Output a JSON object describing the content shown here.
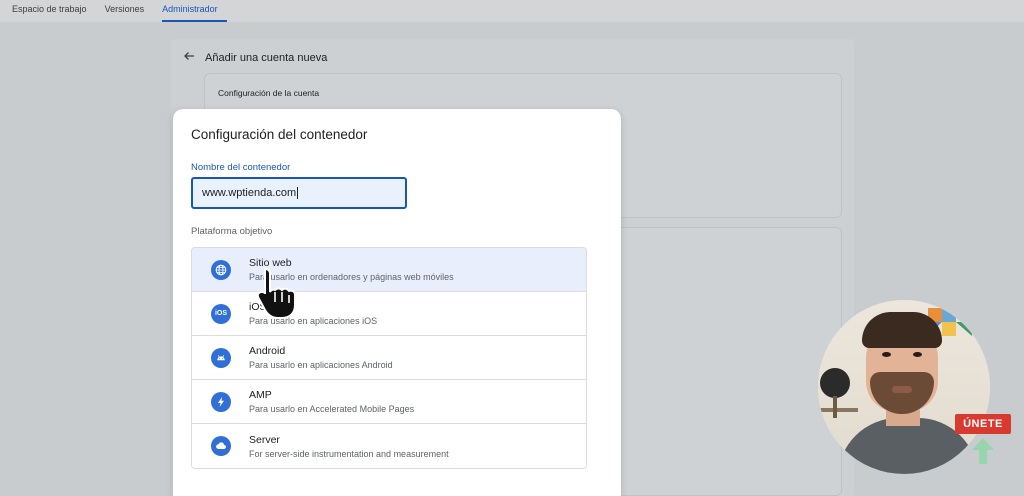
{
  "topnav": {
    "tabs": [
      {
        "label": "Espacio de trabajo"
      },
      {
        "label": "Versiones"
      },
      {
        "label": "Administrador"
      }
    ],
    "active_tab": "Administrador"
  },
  "background": {
    "back_icon": "arrow-left-icon",
    "title": "Añadir una cuenta nueva",
    "account_section_label": "Configuración de la cuenta"
  },
  "modal": {
    "title": "Configuración del contenedor",
    "container_name_label": "Nombre del contenedor",
    "container_name_value": "www.wptienda.com",
    "platform_label": "Plataforma objetivo",
    "platforms": [
      {
        "name": "Sitio web",
        "desc": "Para usarlo en ordenadores y páginas web móviles",
        "icon": "globe-icon",
        "selected": true
      },
      {
        "name": "iOS",
        "desc": "Para usarlo en aplicaciones iOS",
        "icon": "ios-icon",
        "icon_text": "iOS",
        "selected": false
      },
      {
        "name": "Android",
        "desc": "Para usarlo en aplicaciones Android",
        "icon": "android-icon",
        "selected": false
      },
      {
        "name": "AMP",
        "desc": "Para usarlo en Accelerated Mobile Pages",
        "icon": "lightning-icon",
        "selected": false
      },
      {
        "name": "Server",
        "desc": "For server-side instrumentation and measurement",
        "icon": "cloud-icon",
        "selected": false
      }
    ]
  },
  "overlay": {
    "join_badge": "ÚNETE"
  },
  "colors": {
    "accent": "#1a56b8",
    "icon_blue": "#2f6fd6",
    "selected_row": "#e8eefb",
    "badge_red": "#d93a2f",
    "arrow_green": "#8fd6a8"
  }
}
